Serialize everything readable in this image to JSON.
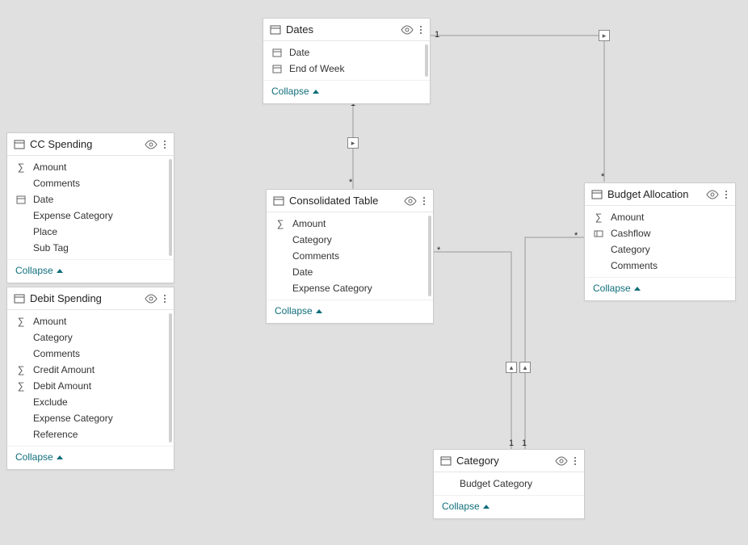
{
  "collapse_label": "Collapse",
  "tables": {
    "dates": {
      "title": "Dates",
      "fields": [
        {
          "icon": "date",
          "name": "Date"
        },
        {
          "icon": "date",
          "name": "End of Week"
        }
      ]
    },
    "cc_spending": {
      "title": "CC Spending",
      "fields": [
        {
          "icon": "sum",
          "name": "Amount"
        },
        {
          "icon": "",
          "name": "Comments"
        },
        {
          "icon": "date",
          "name": "Date"
        },
        {
          "icon": "",
          "name": "Expense Category"
        },
        {
          "icon": "",
          "name": "Place"
        },
        {
          "icon": "",
          "name": "Sub Tag"
        }
      ]
    },
    "debit_spending": {
      "title": "Debit Spending",
      "fields": [
        {
          "icon": "sum",
          "name": "Amount"
        },
        {
          "icon": "",
          "name": "Category"
        },
        {
          "icon": "",
          "name": "Comments"
        },
        {
          "icon": "sum",
          "name": "Credit Amount"
        },
        {
          "icon": "sum",
          "name": "Debit Amount"
        },
        {
          "icon": "",
          "name": "Exclude"
        },
        {
          "icon": "",
          "name": "Expense Category"
        },
        {
          "icon": "",
          "name": "Reference"
        }
      ]
    },
    "consolidated": {
      "title": "Consolidated Table",
      "fields": [
        {
          "icon": "sum",
          "name": "Amount"
        },
        {
          "icon": "",
          "name": "Category"
        },
        {
          "icon": "",
          "name": "Comments"
        },
        {
          "icon": "",
          "name": "Date"
        },
        {
          "icon": "",
          "name": "Expense Category"
        }
      ]
    },
    "budget_allocation": {
      "title": "Budget Allocation",
      "fields": [
        {
          "icon": "sum",
          "name": "Amount"
        },
        {
          "icon": "cash",
          "name": "Cashflow"
        },
        {
          "icon": "",
          "name": "Category"
        },
        {
          "icon": "",
          "name": "Comments"
        }
      ]
    },
    "category": {
      "title": "Category",
      "fields": [
        {
          "icon": "",
          "name": "Budget Category"
        }
      ]
    }
  },
  "cardinality": {
    "one": "1",
    "many": "*"
  }
}
